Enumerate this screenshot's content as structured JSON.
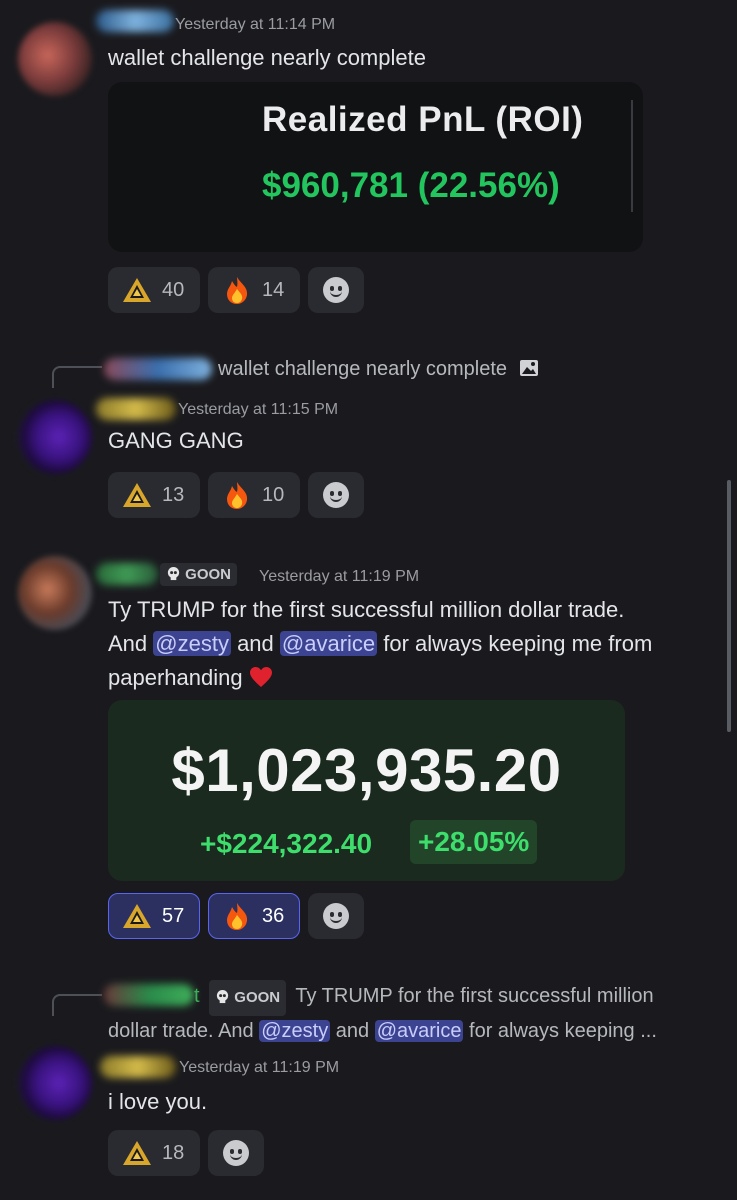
{
  "messages": [
    {
      "timestamp": "Yesterday at 11:14 PM",
      "text": "wallet challenge nearly complete",
      "image": {
        "title": "Realized PnL (ROI)",
        "value": "$960,781 (22.56%)"
      },
      "reactions": [
        {
          "emoji": "pyramid-icon",
          "count": "40",
          "active": false
        },
        {
          "emoji": "fire-icon",
          "count": "14",
          "active": false
        }
      ]
    },
    {
      "reply_text": "wallet challenge nearly complete",
      "timestamp": "Yesterday at 11:15 PM",
      "text": "GANG GANG",
      "reactions": [
        {
          "emoji": "pyramid-icon",
          "count": "13",
          "active": false
        },
        {
          "emoji": "fire-icon",
          "count": "10",
          "active": false
        }
      ]
    },
    {
      "badge": "GOON",
      "timestamp": "Yesterday at 11:19 PM",
      "text_parts": {
        "line1": "Ty TRUMP for the first successful million dollar trade.",
        "and1": "And ",
        "mention1": "@zesty",
        "and2": " and ",
        "mention2": "@avarice",
        "rest": " for always keeping me from",
        "line3": "paperhanding "
      },
      "image": {
        "balance": "$1,023,935.20",
        "delta": "+$224,322.40",
        "pct": "+28.05%"
      },
      "reactions": [
        {
          "emoji": "pyramid-icon",
          "count": "57",
          "active": true
        },
        {
          "emoji": "fire-icon",
          "count": "36",
          "active": true
        }
      ]
    },
    {
      "reply": {
        "name_tail": "t",
        "badge": "GOON",
        "line1": "Ty TRUMP for the first successful million",
        "line2_a": "dollar trade. And ",
        "mention1": "@zesty",
        "and": " and ",
        "mention2": "@avarice",
        "line2_b": " for always keeping ..."
      },
      "timestamp": "Yesterday at 11:19 PM",
      "text": "i love you.",
      "reactions": [
        {
          "emoji": "pyramid-icon",
          "count": "18",
          "active": false
        }
      ]
    }
  ],
  "colors": {
    "background": "#1a1a1e",
    "mention_bg": "#3c4391",
    "active_reaction_border": "#5865f2",
    "green": "#23c55e"
  }
}
